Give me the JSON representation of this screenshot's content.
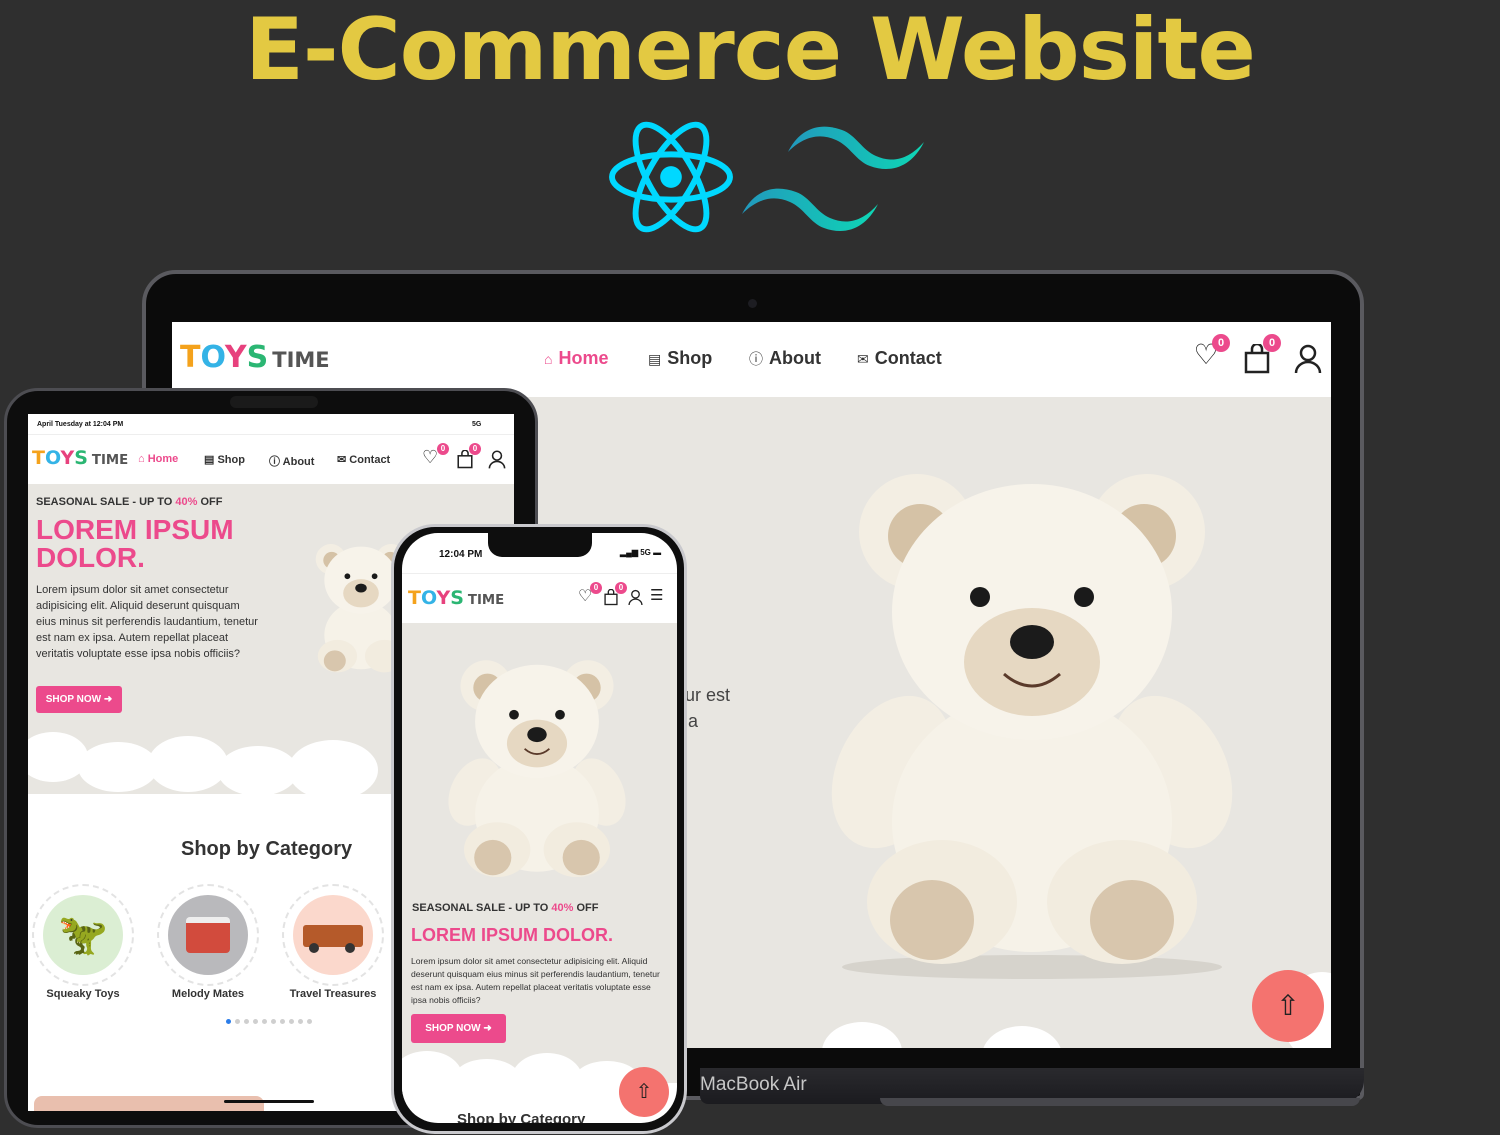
{
  "page_title": "E-Commerce Website",
  "tech_icons": [
    "react-icon",
    "tailwind-icon"
  ],
  "brand": {
    "logo_word": "TOYS",
    "logo_suffix": "TIME"
  },
  "nav": {
    "home": "Home",
    "shop": "Shop",
    "about": "About",
    "contact": "Contact",
    "wishlist_count": "0",
    "cart_count": "0"
  },
  "laptop": {
    "label": "MacBook Air",
    "hero_fragment_1": "tur est",
    "hero_fragment_2": "a"
  },
  "tablet": {
    "status_time": "April Tuesday at 12:04 PM",
    "status_network": "5G",
    "sale_prefix": "SEASONAL SALE - UP TO ",
    "sale_percent": "40%",
    "sale_suffix": " OFF",
    "headline": "LOREM IPSUM DOLOR.",
    "body": "Lorem ipsum dolor sit amet consectetur adipisicing elit. Aliquid deserunt quisquam eius minus sit perferendis laudantium, tenetur est nam ex ipsa. Autem repellat placeat veritatis voluptate esse ipsa nobis officiis?",
    "cta": "SHOP NOW",
    "category_heading": "Shop by Category",
    "categories": [
      "Squeaky Toys",
      "Melody Mates",
      "Travel Treasures"
    ],
    "carousel_dots": 10,
    "carousel_active": 0
  },
  "phone": {
    "status_time": "12:04 PM",
    "status_network": "5G",
    "sale_prefix": "SEASONAL SALE - UP TO ",
    "sale_percent": "40%",
    "sale_suffix": " OFF",
    "headline": "LOREM IPSUM DOLOR.",
    "body": "Lorem ipsum dolor sit amet consectetur adipisicing elit. Aliquid deserunt quisquam eius minus sit perferendis laudantium, tenetur est nam ex ipsa. Autem repellat placeat veritatis voluptate esse ipsa nobis officiis?",
    "cta": "SHOP NOW",
    "next_heading": "Shop by Category"
  },
  "colors": {
    "accent": "#ec4a8c",
    "title": "#e3c942",
    "react": "#00d8ff",
    "tailwind": "#38bdf8",
    "scroll_button": "#f4736f"
  }
}
